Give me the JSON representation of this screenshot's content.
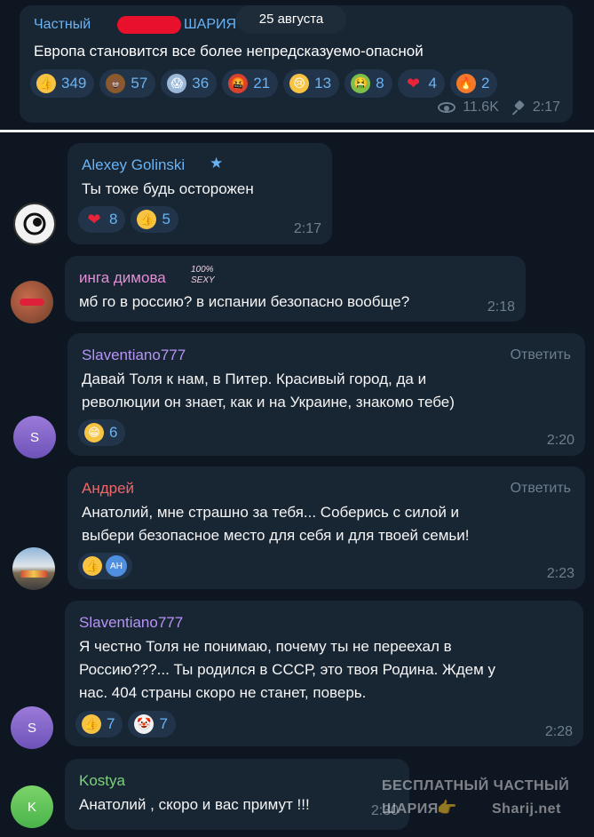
{
  "post": {
    "channel_name_visible_start": "Частный",
    "channel_name_visible_end": "ШАРИЯ",
    "date_pill": "25 августа",
    "text": "Европа становится все более непредсказуемо-опасной",
    "reactions": [
      {
        "icon": "thumbs-up-icon",
        "count": "349"
      },
      {
        "icon": "poop-icon",
        "count": "57"
      },
      {
        "icon": "scream-face-icon",
        "count": "36"
      },
      {
        "icon": "cursing-face-icon",
        "count": "21"
      },
      {
        "icon": "crying-face-icon",
        "count": "13"
      },
      {
        "icon": "vomiting-face-icon",
        "count": "8"
      },
      {
        "icon": "heart-icon",
        "count": "4"
      },
      {
        "icon": "fire-icon",
        "count": "2"
      }
    ],
    "views": "11.6K",
    "time": "2:17"
  },
  "comments": [
    {
      "author": "Alexey Golinski",
      "text": "Ты тоже будь осторожен",
      "reactions": [
        {
          "icon": "heart-icon",
          "count": "8"
        },
        {
          "icon": "thumbs-up-icon",
          "count": "5"
        }
      ],
      "time": "2:17"
    },
    {
      "author": "инга димова",
      "badge": "100% SEXY",
      "text": "мб го в россию? в испании безопасно вообще?",
      "time": "2:18"
    },
    {
      "author": "Slaventiano777",
      "reply": "Ответить",
      "text_lines": [
        "Давай Толя к нам, в Питер. Красивый город, да и",
        "революции он знает, как и на Украине, знакомо тебе)"
      ],
      "reactions": [
        {
          "icon": "grinning-face-icon",
          "count": "6"
        }
      ],
      "avatar_letter": "S",
      "time": "2:20"
    },
    {
      "author": "Андрей",
      "reply": "Ответить",
      "text_lines": [
        "Анатолий, мне страшно за тебя... Соберись с силой и",
        "выбери безопасное место для себя и для твоей семьи!"
      ],
      "reactor_initials": "AH",
      "time": "2:23"
    },
    {
      "author": "Slaventiano777",
      "text_lines": [
        "Я честно Толя не понимаю, почему ты не переехал в",
        "Россию???... Ты родился в СССР, это твоя Родина. Ждем у",
        "нас. 404 страны скоро не станет, поверь."
      ],
      "reactions": [
        {
          "icon": "thumbs-up-icon",
          "count": "7"
        },
        {
          "icon": "clown-face-icon",
          "count": "7"
        }
      ],
      "avatar_letter": "S",
      "time": "2:28"
    },
    {
      "author": "Kostya",
      "text": "Анатолий , скоро и вас примут !!!",
      "avatar_letter": "K",
      "time": "2:30"
    }
  ],
  "watermark": {
    "line1": "БЕСПЛАТНЫЙ ЧАСТНЫЙ",
    "line2": "ШАРИЯ",
    "line3": "Sharij.net"
  },
  "colors": {
    "background": "#0e1621",
    "bubble": "#182533",
    "link": "#6ab3f3",
    "meta": "#6d7f8f"
  }
}
